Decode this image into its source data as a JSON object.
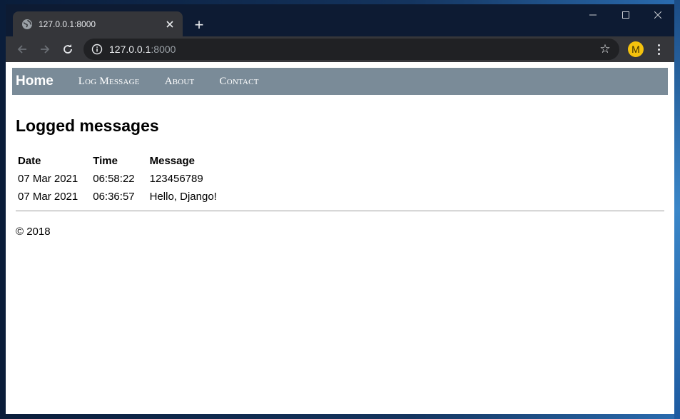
{
  "browser": {
    "tab_title": "127.0.0.1:8000",
    "new_tab_label": "+",
    "url_host": "127.0.0.1",
    "url_port": ":8000",
    "profile_initial": "M",
    "accent_color": "#f4c20d"
  },
  "navbar": {
    "brand": "Home",
    "links": [
      "Log Message",
      "About",
      "Contact"
    ],
    "background": "#7a8b98"
  },
  "main": {
    "title": "Logged messages",
    "table": {
      "headers": [
        "Date",
        "Time",
        "Message"
      ],
      "rows": [
        [
          "07 Mar 2021",
          "06:58:22",
          "123456789"
        ],
        [
          "07 Mar 2021",
          "06:36:57",
          "Hello, Django!"
        ]
      ]
    }
  },
  "footer": {
    "text": "© 2018"
  },
  "icons": {
    "favicon": "globe-icon",
    "back": "back-arrow-icon",
    "forward": "forward-arrow-icon",
    "reload": "reload-icon",
    "site_info": "info-icon",
    "bookmark": "star-icon",
    "menu": "kebab-menu-icon"
  }
}
